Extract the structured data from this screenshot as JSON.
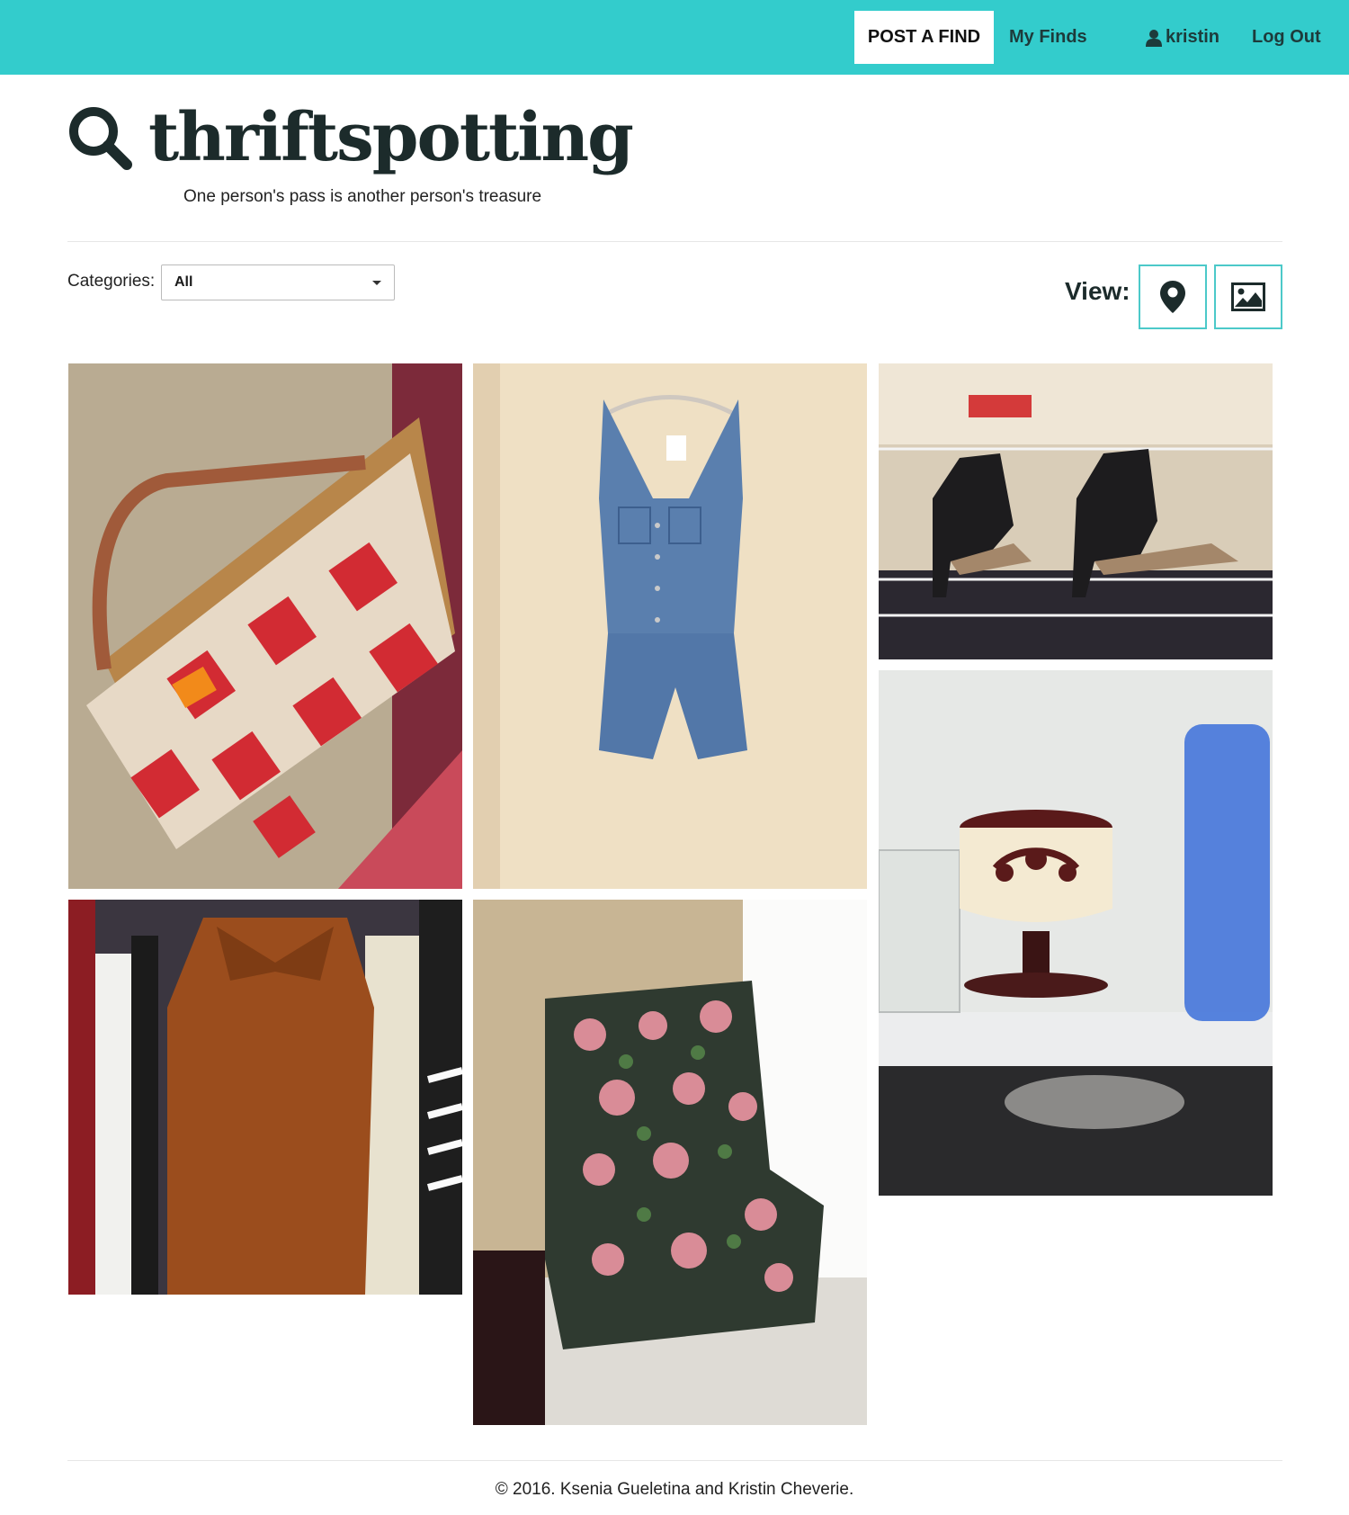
{
  "nav": {
    "post_label": "POST A FIND",
    "my_finds_label": "My Finds",
    "user_label": "kristin",
    "logout_label": "Log Out"
  },
  "header": {
    "logo_text": "thriftspotting",
    "tagline": "One person's pass is another person's treasure"
  },
  "filters": {
    "categories_label": "Categories:",
    "categories_value": "All",
    "view_label": "View:"
  },
  "icons": {
    "logo": "search-icon",
    "user": "user-icon",
    "map_view": "map-pin-icon",
    "grid_view": "image-icon",
    "dropdown": "caret-down-icon"
  },
  "colors": {
    "accent": "#33cccc",
    "view_border": "#4cc9c9",
    "logo": "#1c2b2b"
  },
  "photos": [
    {
      "id": "picnic-basket"
    },
    {
      "id": "denim-romper"
    },
    {
      "id": "black-boots"
    },
    {
      "id": "enamel-pot"
    },
    {
      "id": "brown-dress"
    },
    {
      "id": "floral-armchair"
    }
  ],
  "footer": {
    "copyright": "© 2016. Ksenia Gueletina and Kristin Cheverie."
  }
}
